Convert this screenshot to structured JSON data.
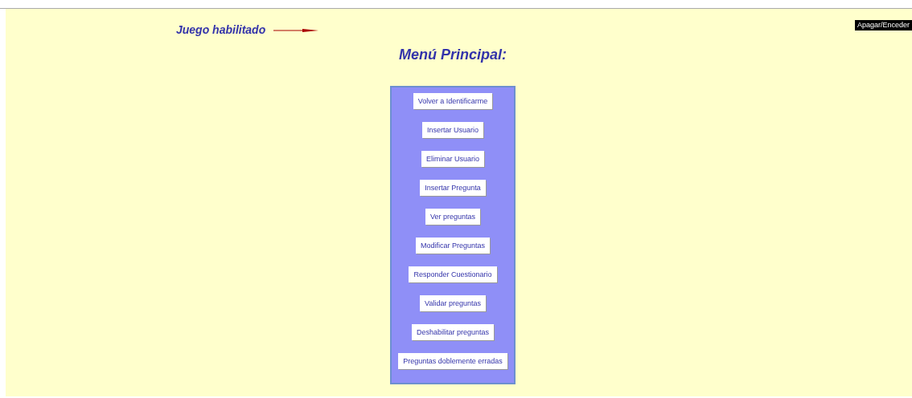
{
  "status": {
    "text": "Juego habilitado",
    "enabled": true
  },
  "toggle_button": "Apagar/Enceder",
  "title": "Menú Principal:",
  "menu": [
    "Volver a Identificarme",
    "Insertar Usuario",
    "Eliminar Usuario",
    "Insertar Pregunta",
    "Ver preguntas",
    "Modificar Preguntas",
    "Responder Cuestionario",
    "Validar preguntas",
    "Deshabilitar preguntas",
    "Preguntas doblemente erradas"
  ]
}
